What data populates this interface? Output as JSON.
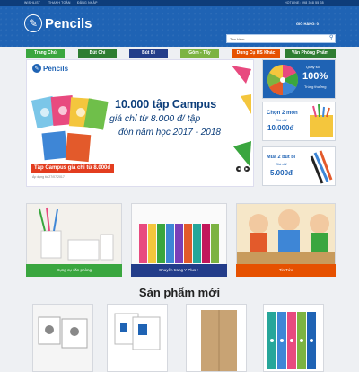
{
  "topbar": {
    "links": [
      "WISHLIST",
      "THANH TOÁN",
      "ĐĂNG NHẬP"
    ],
    "hotline": "HOTLINE: 098 368 55 35"
  },
  "header": {
    "logo_text": "Pencils",
    "logo_sub": "",
    "cart_label": "GIỎ HÀNG: 0",
    "search_placeholder": "Tìm kiếm"
  },
  "nav": {
    "items": [
      {
        "label": "Trang Chủ",
        "color": "#3aa63f"
      },
      {
        "label": "Bút Chì",
        "color": "#2e7d32"
      },
      {
        "label": "Bút Bi",
        "color": "#233d8a"
      },
      {
        "label": "Gôm - Tẩy",
        "color": "#7cb342"
      },
      {
        "label": "Dụng Cụ HS Khác",
        "color": "#e65100"
      },
      {
        "label": "Văn Phòng Phẩm",
        "color": "#2f7d32"
      }
    ]
  },
  "banner": {
    "logo": "Pencils",
    "headline": "10.000 tập Campus",
    "price_line": "giá chỉ từ 8.000 đ/ tập",
    "year_line": "đón năm học 2017 - 2018",
    "caption": "Tập Campus giá chỉ từ 8.000đ",
    "posted": "Áp dụng từ 27/07/2017"
  },
  "sidebar": {
    "promo1_text": "Quay số",
    "promo1_value": "100%",
    "promo1_sub": "Trúng thưởng",
    "promo2_line1": "Chọn 2 món",
    "promo2_line2": "Giá chỉ",
    "promo2_price": "10.000đ",
    "promo3_line1": "Mua 2 bút bi",
    "promo3_line2": "Giá chỉ",
    "promo3_price": "5.000đ"
  },
  "categories": [
    {
      "label": "Dụng cụ văn phòng",
      "color": "#3aa63f"
    },
    {
      "label": "Chuyên trang Y Plus +",
      "color": "#233d8a"
    },
    {
      "label": "Tin Tức",
      "color": "#e65100"
    }
  ],
  "products_title": "Sản phẩm mới"
}
